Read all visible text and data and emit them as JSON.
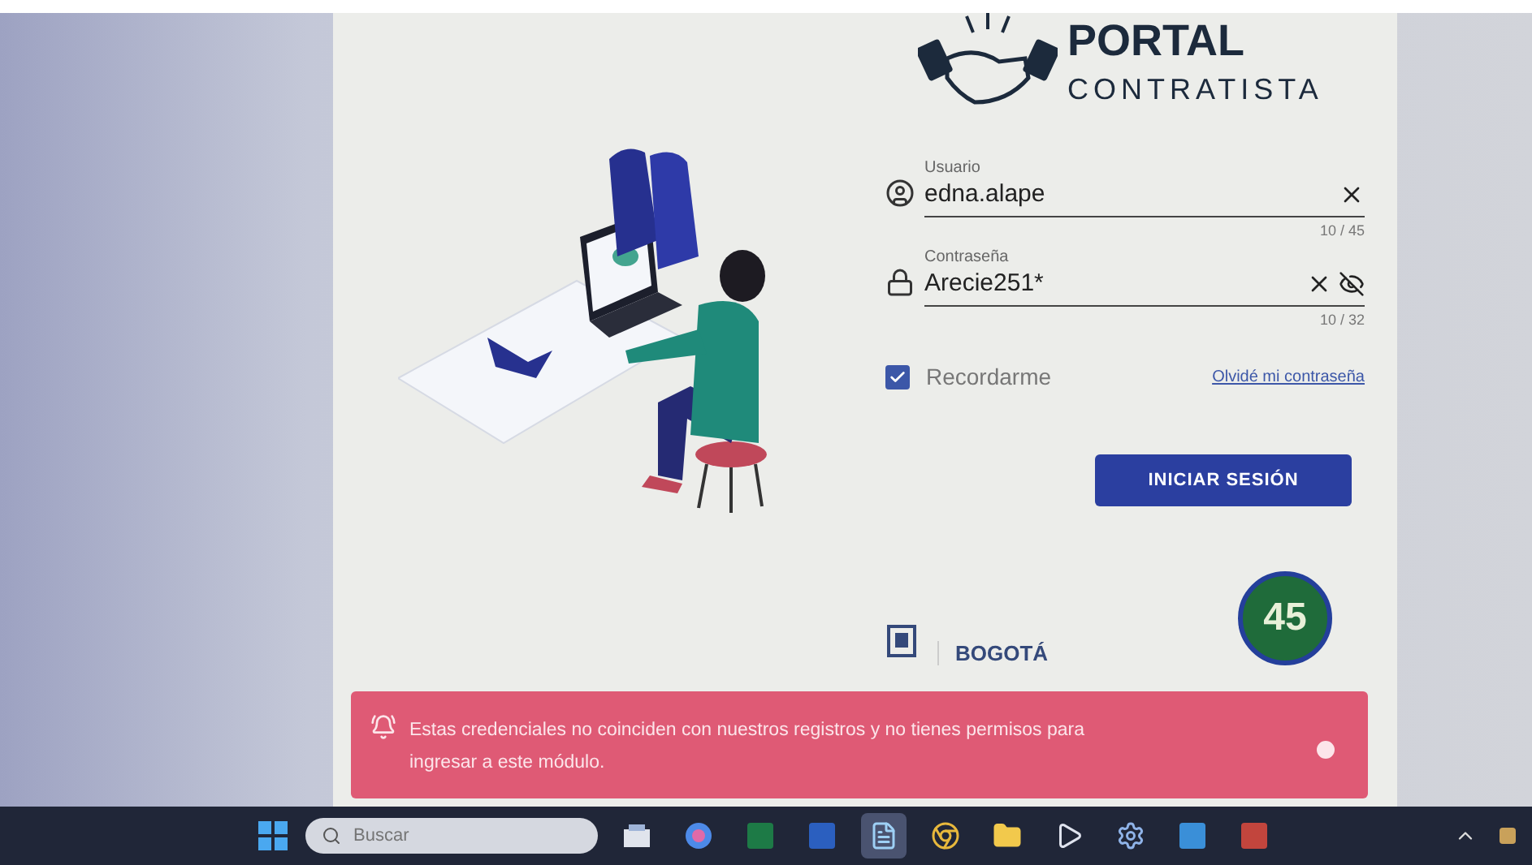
{
  "header": {
    "title": "PORTAL",
    "subtitle": "CONTRATISTA"
  },
  "fields": [
    {
      "kind": "user",
      "label": "Usuario",
      "value": "edna.alape",
      "counter": "10 / 45"
    },
    {
      "kind": "password",
      "label": "Contraseña",
      "value": "Arecie251*",
      "counter": "10 / 32"
    }
  ],
  "remember": {
    "label": "Recordarme",
    "checked": true
  },
  "forgot_link": "Olvidé mi contraseña",
  "login_button": "INICIAR SESIÓN",
  "footer_logos": {
    "city": "BOGOTÁ",
    "badge": "45"
  },
  "toast": {
    "message": "Estas credenciales no coinciden con nuestros registros y no tienes permisos para ingresar a este módulo."
  },
  "taskbar": {
    "search_placeholder": "Buscar",
    "apps": [
      {
        "kind": "widgets",
        "selected": false
      },
      {
        "kind": "copilot",
        "selected": false
      },
      {
        "kind": "excel",
        "selected": false
      },
      {
        "kind": "word",
        "selected": false
      },
      {
        "kind": "notepad",
        "selected": true
      },
      {
        "kind": "chrome",
        "selected": false
      },
      {
        "kind": "folder",
        "selected": false
      },
      {
        "kind": "media",
        "selected": false
      },
      {
        "kind": "settings",
        "selected": false
      },
      {
        "kind": "store",
        "selected": false
      },
      {
        "kind": "photos",
        "selected": false
      }
    ]
  }
}
